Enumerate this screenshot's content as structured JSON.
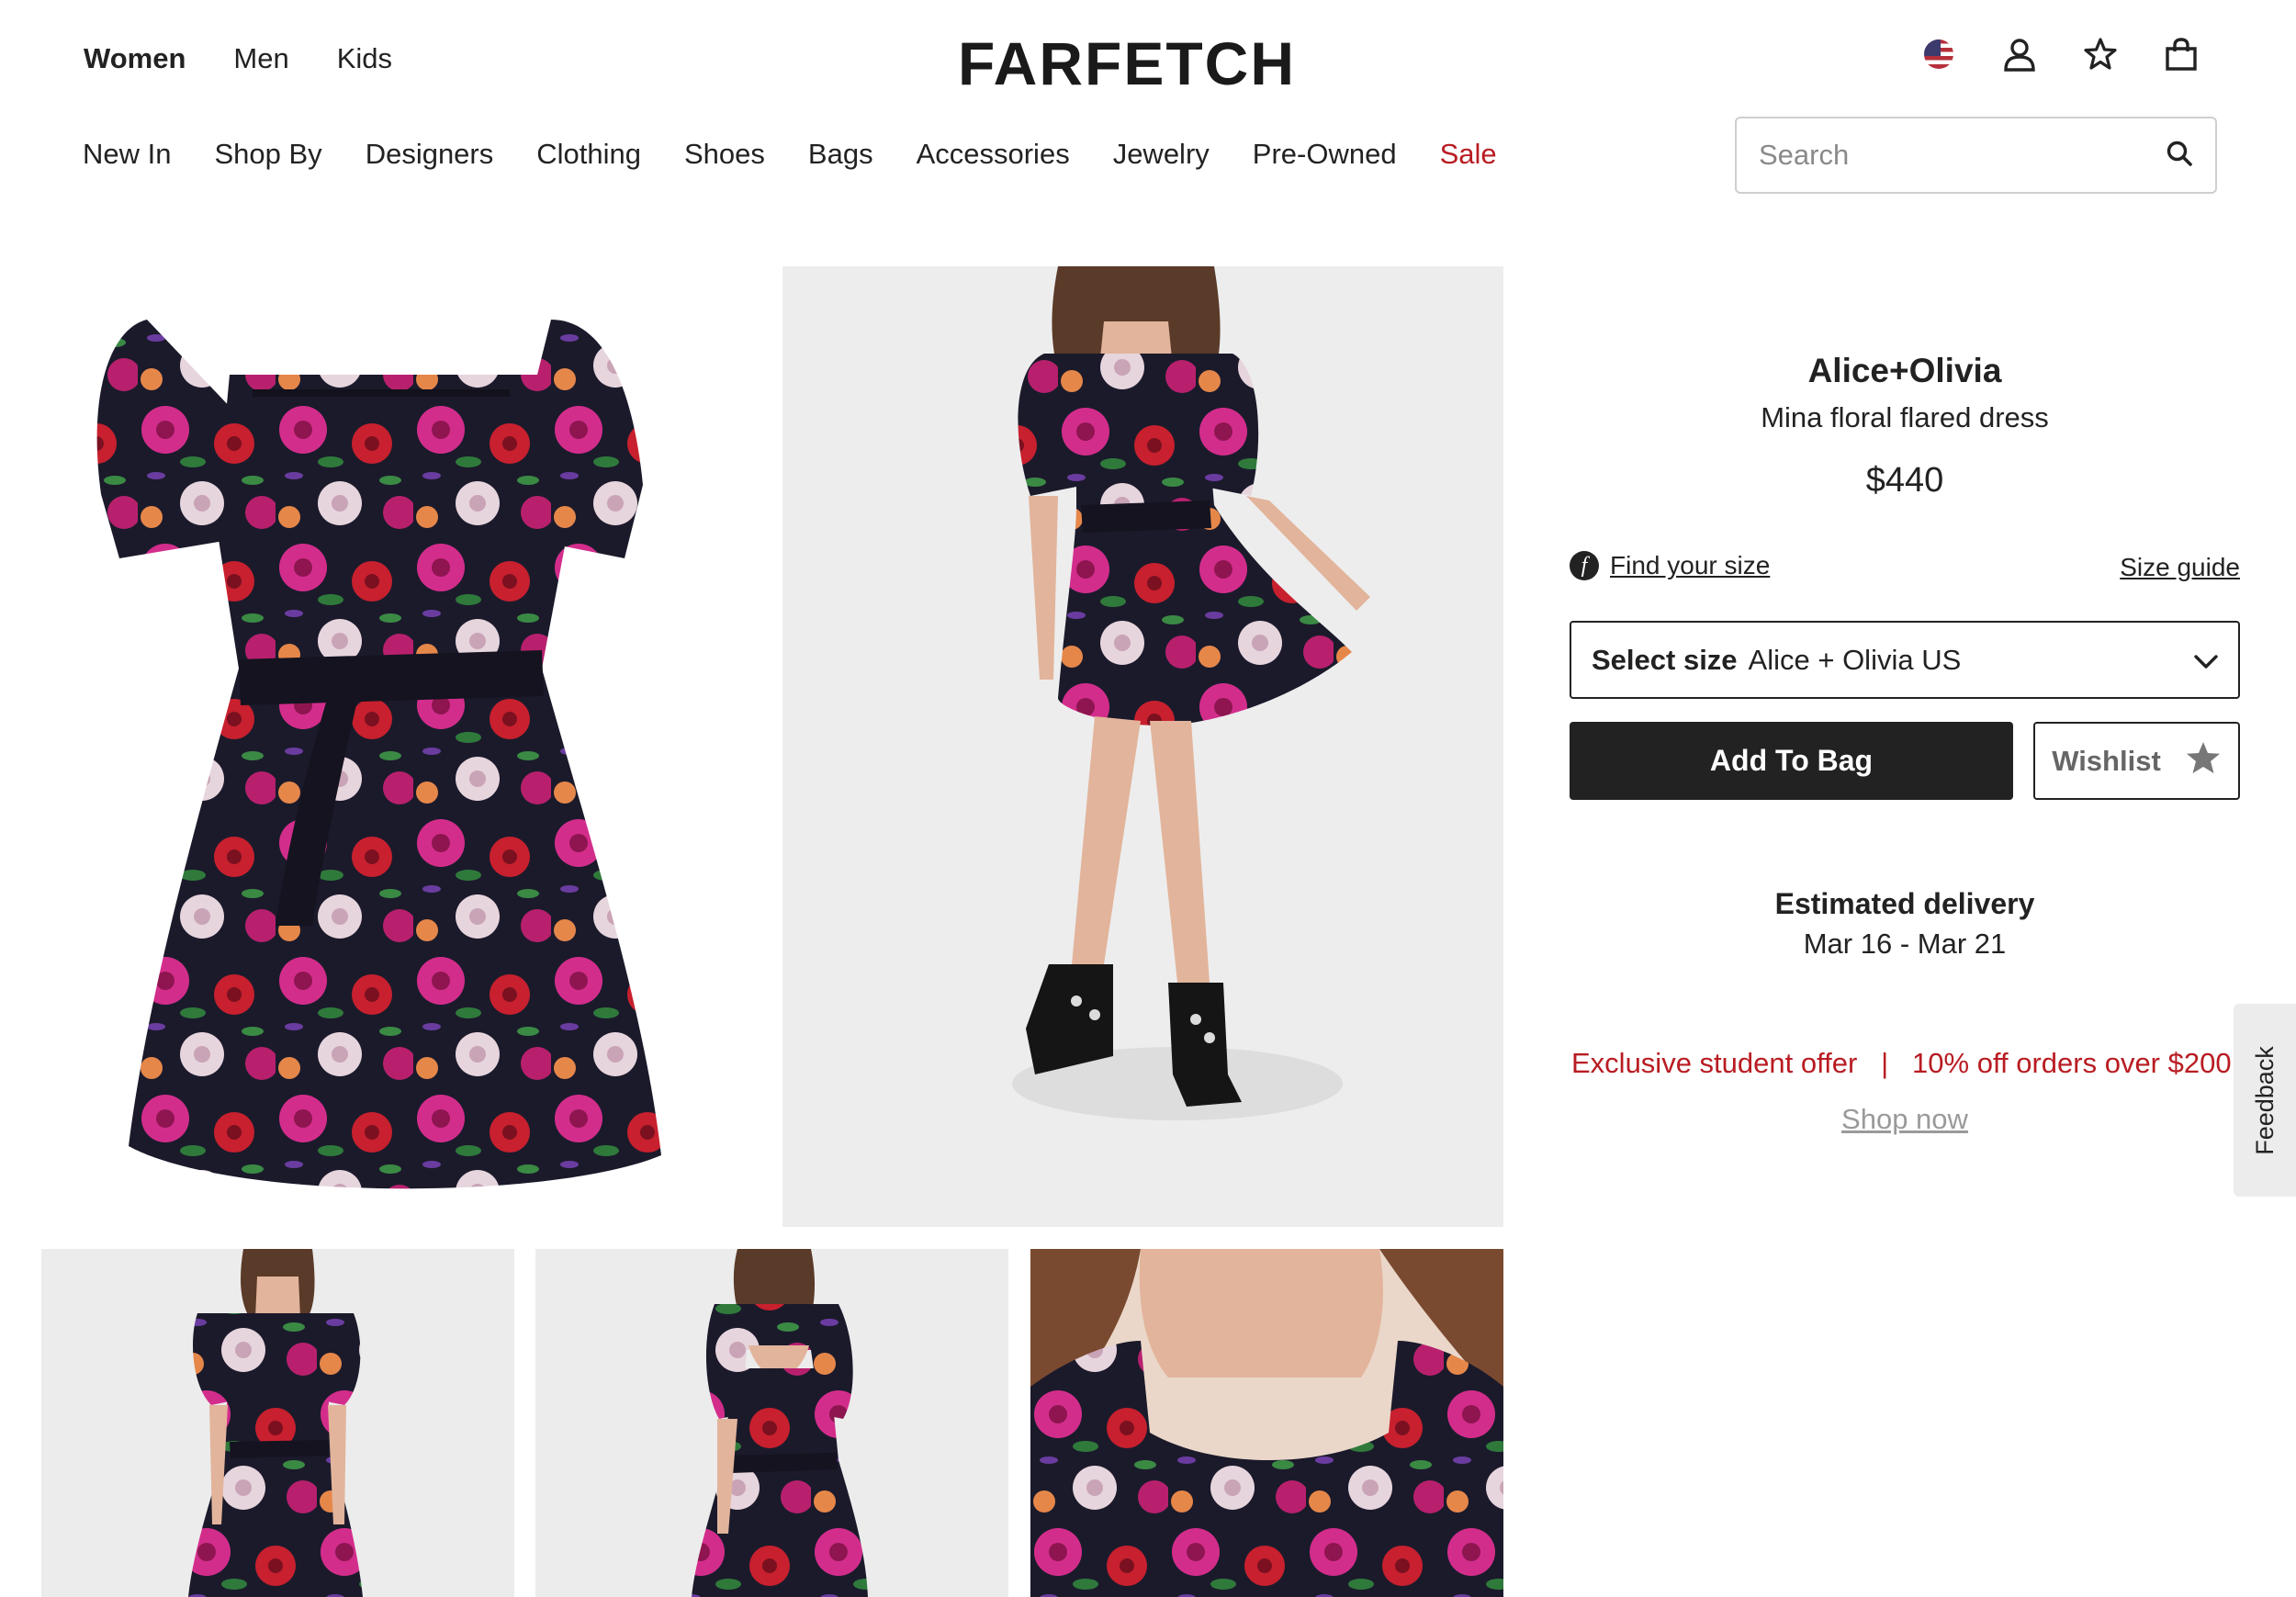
{
  "header": {
    "gender_tabs": [
      "Women",
      "Men",
      "Kids"
    ],
    "logo": "FARFETCH",
    "icons": [
      "us-flag-icon",
      "account-icon",
      "wishlist-star-icon",
      "bag-icon"
    ]
  },
  "categories": [
    "New In",
    "Shop By",
    "Designers",
    "Clothing",
    "Shoes",
    "Bags",
    "Accessories",
    "Jewelry",
    "Pre-Owned",
    "Sale"
  ],
  "search": {
    "placeholder": "Search",
    "icon": "search-icon"
  },
  "product": {
    "brand": "Alice+Olivia",
    "name": "Mina floral flared dress",
    "price": "$440",
    "find_size": "Find your size",
    "size_guide": "Size guide",
    "select_size_label": "Select size",
    "select_size_value": "Alice + Olivia US",
    "add_to_bag": "Add To Bag",
    "wishlist": "Wishlist"
  },
  "delivery": {
    "title": "Estimated delivery",
    "dates": "Mar 16 - Mar 21"
  },
  "promo": {
    "text": "Exclusive student offer   |   10% off orders over $200",
    "link": "Shop now"
  },
  "feedback": "Feedback",
  "colors": {
    "sale_red": "#b81c22",
    "primary_dark": "#222222",
    "dress_base": "#1b1a2b",
    "flower_magenta": "#d32d8c",
    "flower_red": "#c8202e"
  }
}
